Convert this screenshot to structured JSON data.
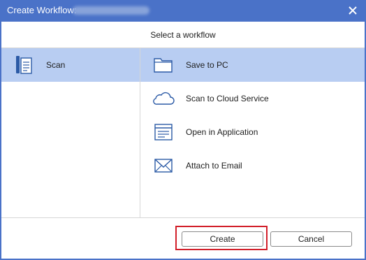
{
  "titlebar": {
    "title": "Create Workflow:",
    "close_icon": "close-icon"
  },
  "header": {
    "label": "Select a workflow"
  },
  "sources": [
    {
      "label": "Scan",
      "icon": "scanner-document-icon",
      "selected": true
    }
  ],
  "destinations": [
    {
      "label": "Save to PC",
      "icon": "folder-icon",
      "selected": true
    },
    {
      "label": "Scan to Cloud Service",
      "icon": "cloud-icon",
      "selected": false
    },
    {
      "label": "Open in Application",
      "icon": "application-window-icon",
      "selected": false
    },
    {
      "label": "Attach to Email",
      "icon": "envelope-icon",
      "selected": false
    }
  ],
  "footer": {
    "create_label": "Create",
    "cancel_label": "Cancel"
  },
  "colors": {
    "titlebar": "#4a72c8",
    "selection": "#b8cdf2",
    "icon_blue": "#2b5aa6",
    "highlight_red": "#d21f2a"
  }
}
